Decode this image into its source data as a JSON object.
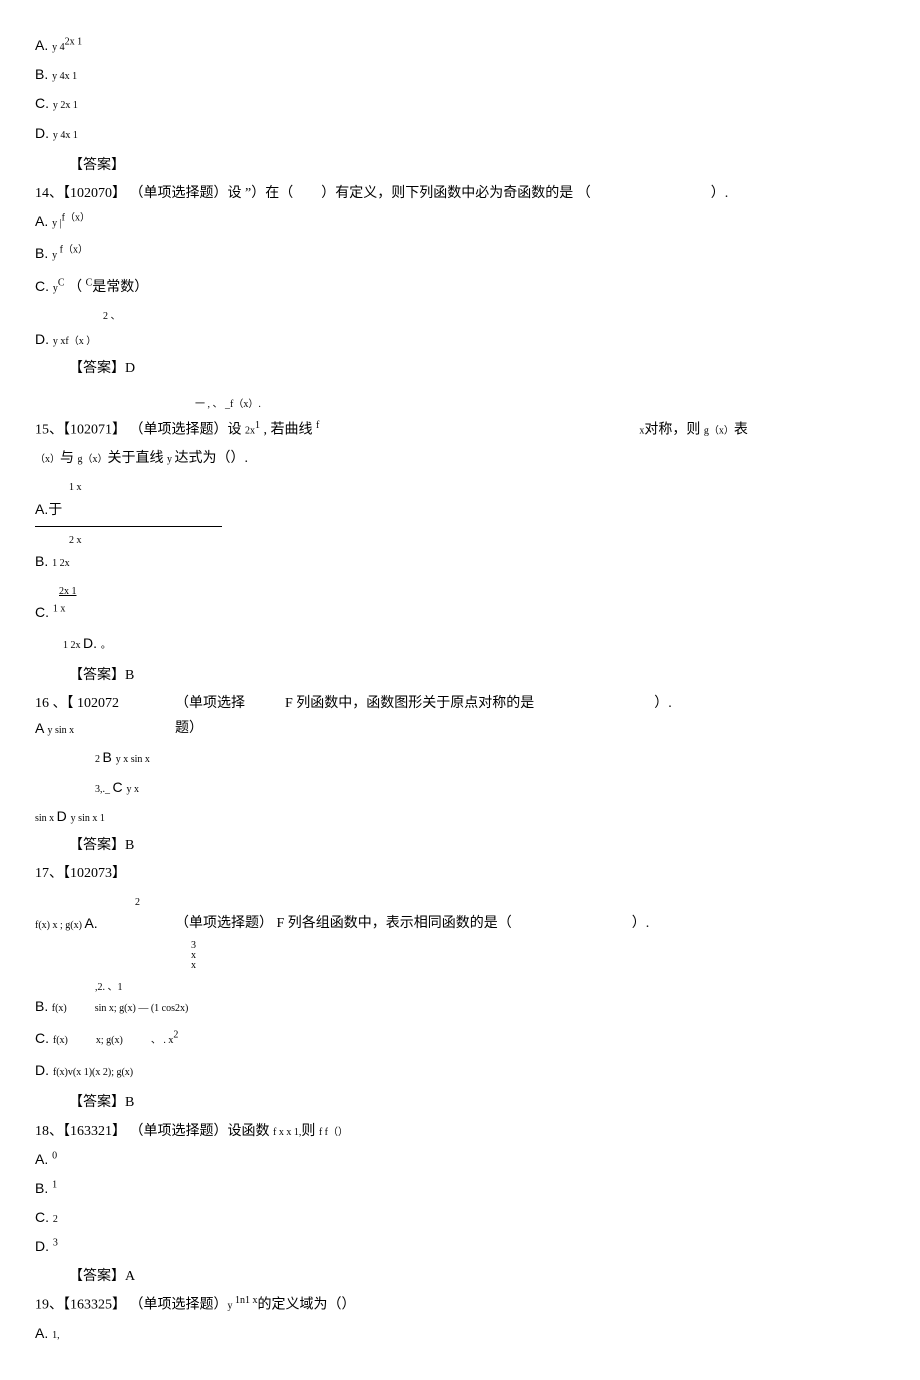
{
  "q13opts": {
    "a_label": "A. ",
    "a_text": "y   4",
    "a_sup": "2x 1",
    "b_label": "B. ",
    "b_text": "y    4x 1",
    "c_label": "C. ",
    "c_text": "y    2x 1",
    "d_label": "D. ",
    "d_text": "y    4x 1"
  },
  "ans_label": "【答案】",
  "q14": {
    "num": "14、",
    "id": "【102070】",
    "type": "（单项选择题）",
    "stem_a": "设 ",
    "stem_quote": "”）",
    "stem_b": "在（",
    "stem_c": "）有定义，则下列函数中必为奇函数的是  （",
    "stem_tail": "）.",
    "a": "A. ",
    "a_t": "y |",
    "a_sup": "f（x）",
    "b": "B. ",
    "b_t": "y ",
    "b_sup": "f（x）",
    "c": "C. ",
    "c_t": "y",
    "c_sup": "C",
    "c_ctx": "（ ",
    "c_sup2": "C",
    "c_tail": "是常数）",
    "d": "D. ",
    "d_t": "y xf（x ）",
    "d_sup": "2  、",
    "ans": "【答案】D"
  },
  "q15": {
    "num": "15、",
    "id": "【102071】",
    "type": "（单项选择题）",
    "stem_a": "设 ",
    "stem_frac": "2x",
    "stem_sup": "1",
    "stem_mid": " , 若曲线 ",
    "stem_f": "f",
    "over_left": "一   ,  、  _",
    "over_right": "f（x）.",
    "stem_x": "x",
    "stem_dsym": "对称，则 ",
    "stem_g": "g（x）",
    "stem_e": "表",
    "line2a": "（x）",
    "line2b": "与 ",
    "line2c": "g（x）",
    "line2d": "关于直线 ",
    "line2e": "y ",
    "line2f": "达式为（）.",
    "a": "A.",
    "a_top": "1  x",
    "a_mid": "于",
    "b_top": "2  x",
    "b": "B. ",
    "b_t": "1 2x",
    "b_under": "2x 1",
    "c": "C. ",
    "c_t": "1 x",
    "c_foot": "1  2x ",
    "d": "D. ",
    "d_t": "。",
    "ans": "【答案】B"
  },
  "q16": {
    "num": "16 、",
    "id": "【 102072",
    "type": "（单项选择  题）",
    "type_a": "（单项选择",
    "type_b": "题）",
    "stem": "F 列函数中，函数图形关于原点对称的是",
    "tail": "）.",
    "a": "A ",
    "a_t": "y sin x",
    "b_pre": "2 ",
    "b": "B ",
    "b_t": "y x sin x",
    "c_pre": "3,._ ",
    "c": "C ",
    "c_t": "y x",
    "foot": "sin x ",
    "d": "D ",
    "d_t": "y sin x 1",
    "ans": "【答案】B"
  },
  "q17": {
    "num": "17、",
    "id": "【102073】",
    "type": "（单项选择题）",
    "stem": "F 列各组函数中，表示相同函数的是（",
    "tail": "）.",
    "a_pre": "f(x) x ; g(x) ",
    "a": "A.",
    "a_sup": "2",
    "frac_top": "3",
    "frac_mid": "x",
    "frac_bot": "x",
    "b": "B.",
    "b_pre": "f(x)",
    "b_mid": "sin x; g(x) — (1 cos2x)",
    "b_sup": ",2.  、1 ",
    "c": "C. ",
    "c_pre": "f(x)",
    "c_mid": "x; g(x)",
    "c_tail": "、 . x",
    "c_sup": "2",
    "d": "D. ",
    "d_t": "f(x)v(x 1)(x 2); g(x)",
    "ans": "【答案】B"
  },
  "q18": {
    "num": "18、",
    "id": "【163321】",
    "type": "（单项选择题）",
    "stem": "设函数 ",
    "f": "f x x 1,",
    "tail": "则 ",
    "ff": "f f（）",
    "a": "A. ",
    "a_t": "0",
    "b": "B. ",
    "b_t": "1",
    "c": "C. ",
    "c_t": "2",
    "d": "D. ",
    "d_t": "3",
    "ans": "【答案】A"
  },
  "q19": {
    "num": "19、",
    "id": "【163325】",
    "type": "（单项选择题）",
    "stem": "y ",
    "sup": "1n1 x",
    "tail": "的定义域为（）",
    "a": "A.    ",
    "a_t": "1,"
  }
}
